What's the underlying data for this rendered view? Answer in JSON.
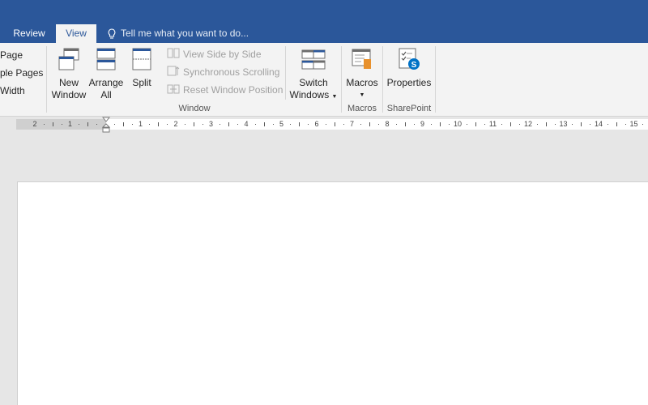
{
  "tabs": {
    "review": "Review",
    "view": "View"
  },
  "tell_me": "Tell me what you want to do...",
  "ribbon": {
    "zoom_partial": {
      "page": "Page",
      "multiple_pages": "ple Pages",
      "page_width": "Width"
    },
    "window_group": {
      "new_window_line1": "New",
      "new_window_line2": "Window",
      "arrange_all_line1": "Arrange",
      "arrange_all_line2": "All",
      "split": "Split",
      "view_side_by_side": "View Side by Side",
      "synchronous_scrolling": "Synchronous Scrolling",
      "reset_window_position": "Reset Window Position",
      "switch_windows_line1": "Switch",
      "switch_windows_line2": "Windows",
      "label": "Window"
    },
    "macros_group": {
      "macros": "Macros",
      "label": "Macros"
    },
    "sharepoint_group": {
      "properties": "Properties",
      "label": "SharePoint"
    }
  },
  "ruler": {
    "left_numbers": [
      "2",
      "1"
    ],
    "numbers": [
      "1",
      "2",
      "3",
      "4",
      "5",
      "6",
      "7",
      "8",
      "9",
      "10",
      "11",
      "12",
      "13",
      "14",
      "15"
    ]
  },
  "colors": {
    "accent": "#2b579a",
    "sharepoint": "#0072c6",
    "macro_orange": "#e8912d"
  }
}
